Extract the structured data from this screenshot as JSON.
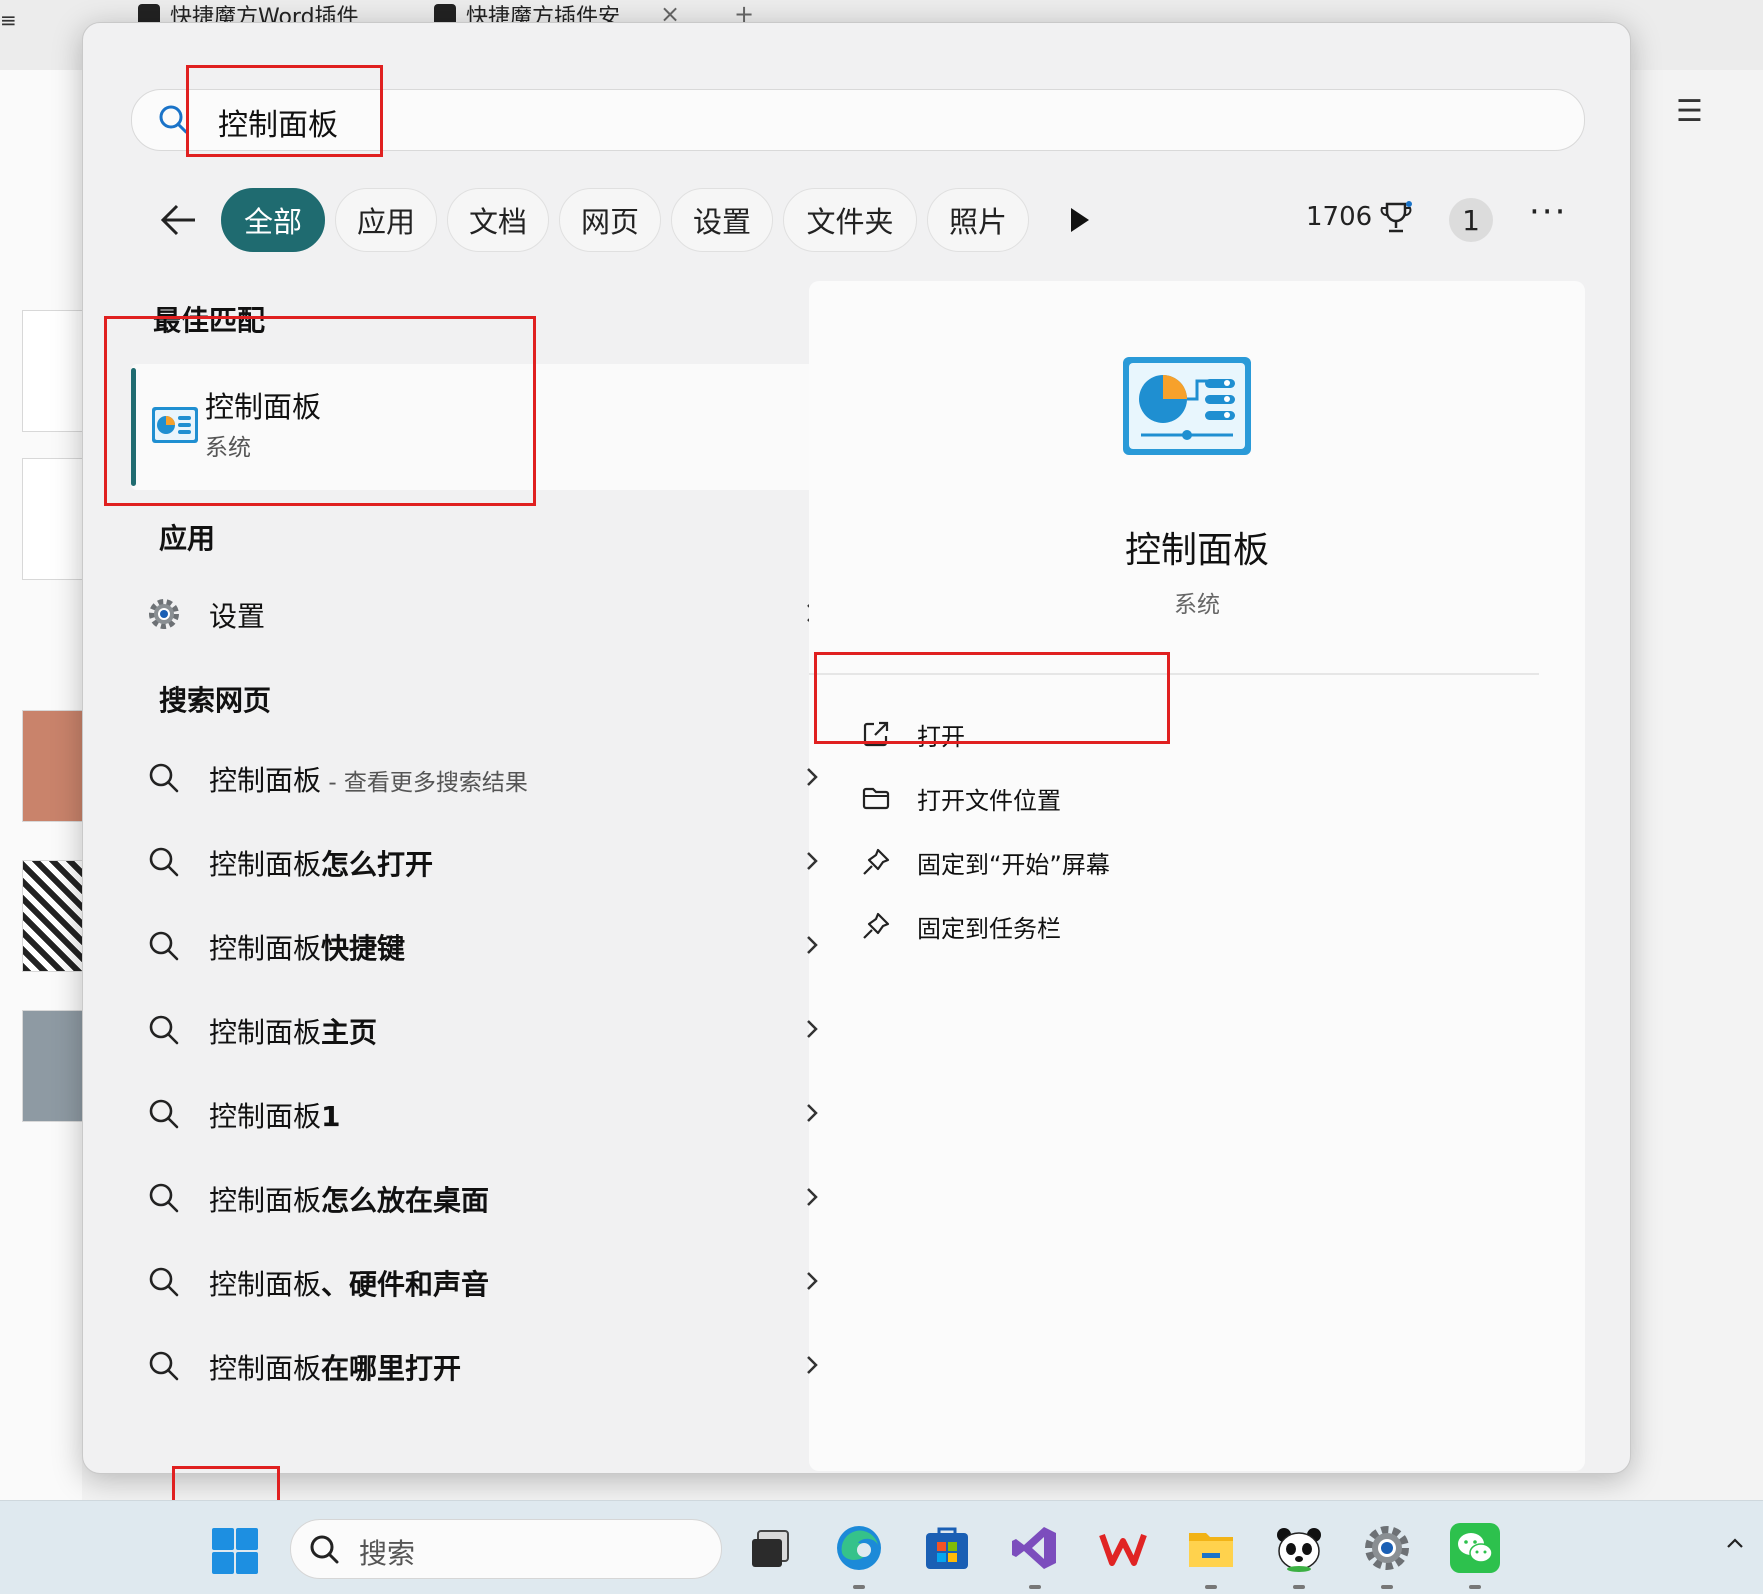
{
  "browser": {
    "tabs": [
      "快捷魔方Word插件",
      "快捷魔方插件安"
    ],
    "tab_close": "×",
    "tab_new": "+"
  },
  "search": {
    "value": "控制面板",
    "icon": "search-icon"
  },
  "filters": {
    "back": "back-arrow-icon",
    "chips": [
      "全部",
      "应用",
      "文档",
      "网页",
      "设置",
      "文件夹",
      "照片"
    ],
    "active": "全部",
    "points": "1706",
    "avatar": "1",
    "more": "···"
  },
  "best_match": {
    "heading": "最佳匹配",
    "title": "控制面板",
    "subtitle": "系统"
  },
  "apps": {
    "heading": "应用",
    "items": [
      {
        "label": "设置",
        "icon": "gear-icon"
      }
    ]
  },
  "web": {
    "heading": "搜索网页",
    "items": [
      {
        "prefix": "控制面板",
        "suffix": "",
        "extra": " - 查看更多搜索结果"
      },
      {
        "prefix": "控制面板",
        "suffix": "怎么打开",
        "extra": ""
      },
      {
        "prefix": "控制面板",
        "suffix": "快捷键",
        "extra": ""
      },
      {
        "prefix": "控制面板",
        "suffix": "主页",
        "extra": ""
      },
      {
        "prefix": "控制面板",
        "suffix": "1",
        "extra": ""
      },
      {
        "prefix": "控制面板",
        "suffix": "怎么放在桌面",
        "extra": ""
      },
      {
        "prefix": "控制面板",
        "suffix": "、硬件和声音",
        "extra": ""
      },
      {
        "prefix": "控制面板",
        "suffix": "在哪里打开",
        "extra": ""
      }
    ]
  },
  "details": {
    "title": "控制面板",
    "subtitle": "系统",
    "actions": [
      {
        "label": "打开",
        "icon": "open-external-icon"
      },
      {
        "label": "打开文件位置",
        "icon": "folder-icon"
      },
      {
        "label": "固定到“开始”屏幕",
        "icon": "pin-icon"
      },
      {
        "label": "固定到任务栏",
        "icon": "pin-icon"
      }
    ]
  },
  "taskbar": {
    "search_placeholder": "搜索",
    "apps": [
      "task-view-icon",
      "edge-icon",
      "store-icon",
      "visual-studio-icon",
      "wps-icon",
      "file-explorer-icon",
      "panda-app-icon",
      "settings-icon",
      "wechat-icon"
    ]
  },
  "colors": {
    "accent": "#1f6b70",
    "highlight": "#e02020"
  }
}
